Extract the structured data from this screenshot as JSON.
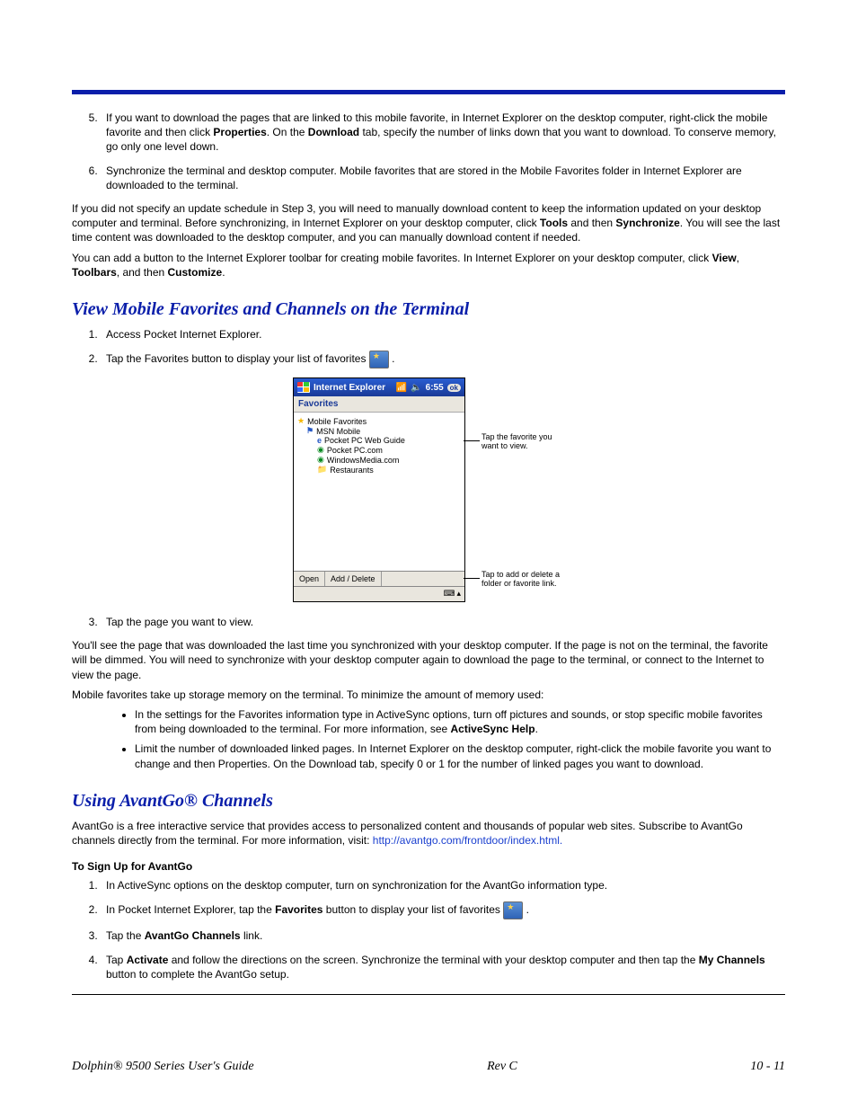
{
  "steps_top": {
    "s5_a": "If you want to download the pages that are linked to this mobile favorite, in Internet Explorer on the desktop computer, right-click the mobile favorite and then click ",
    "s5_b1": "Properties",
    "s5_c": ". On the ",
    "s5_b2": "Download",
    "s5_d": " tab, specify the number of links down that you want to download. To conserve memory, go only one level down.",
    "s6": "Synchronize the terminal and desktop computer. Mobile favorites that are stored in the Mobile Favorites folder in Internet Explorer are downloaded to the terminal."
  },
  "para1": {
    "a": "If you did not specify an update schedule in Step 3, you will need to manually download content to keep the information updated on your desktop computer and terminal. Before synchronizing, in Internet Explorer on your desktop computer, click ",
    "b1": "Tools",
    "b": " and then ",
    "b2": "Synchronize",
    "c": ". You will see the last time content was downloaded to the desktop computer, and you can manually download content if needed."
  },
  "para2": {
    "a": "You can add a button to the Internet Explorer toolbar for creating mobile favorites. In Internet Explorer on your desktop computer, click ",
    "b1": "View",
    "s1": ", ",
    "b2": "Toolbars",
    "s2": ", and then ",
    "b3": "Customize",
    "end": "."
  },
  "heading1": "View Mobile Favorites and Channels on the Terminal",
  "vmf_steps": {
    "s1": "Access Pocket Internet Explorer.",
    "s2": "Tap the Favorites button to display your list of favorites ",
    "s3": "Tap the page you want to view."
  },
  "screenshot": {
    "title": "Internet Explorer",
    "time": "6:55",
    "ok": "ok",
    "fav_label": "Favorites",
    "items": {
      "root": "Mobile Favorites",
      "i1": "MSN Mobile",
      "i2": "Pocket PC Web Guide",
      "i3": "Pocket PC.com",
      "i4": "WindowsMedia.com",
      "i5": "Restaurants"
    },
    "toolbar": {
      "open": "Open",
      "add": "Add / Delete"
    },
    "callout1": "Tap the favorite you want to view.",
    "callout2": "Tap to add or delete a folder or favorite link."
  },
  "para3": "You'll see the page that was downloaded the last time you synchronized with your desktop computer. If the page is not on the terminal, the favorite will be dimmed. You will need to synchronize with your desktop computer again to download the page to the terminal, or connect to the Internet to view the page.",
  "para4": "Mobile favorites take up storage memory on the terminal. To minimize the amount of memory used:",
  "bullets": {
    "b1a": "In the settings for the Favorites information type in ActiveSync options, turn off pictures and sounds, or stop specific mobile favorites from being downloaded to the terminal. For more information, see ",
    "b1b": "ActiveSync Help",
    "b1c": ".",
    "b2": "Limit the number of downloaded linked pages. In Internet Explorer on the desktop computer, right-click the mobile favorite you want to change and then Properties. On the Download tab, specify 0 or 1 for the number of linked pages you want to download."
  },
  "heading2": "Using AvantGo® Channels",
  "avant_intro": {
    "a": "AvantGo is a free interactive service that provides access to personalized content and thousands of popular web sites. Subscribe to AvantGo channels directly from the terminal. For more information, visit:  ",
    "url": "http://avantgo.com/frontdoor/index.html."
  },
  "signup_h": "To Sign Up for AvantGo",
  "signup_steps": {
    "s1": "In ActiveSync options on the desktop computer, turn on synchronization for the AvantGo information type.",
    "s2a": "In Pocket Internet Explorer, tap the ",
    "s2b": "Favorites",
    "s2c": " button to display your list of favorites ",
    "s3a": "Tap the ",
    "s3b": "AvantGo Channels",
    "s3c": " link.",
    "s4a": "Tap ",
    "s4b": "Activate",
    "s4c": " and follow the directions on the screen. Synchronize the terminal with your desktop computer and then tap the ",
    "s4d": "My Channels",
    "s4e": " button to complete the AvantGo setup."
  },
  "footer": {
    "left": "Dolphin® 9500 Series User's Guide",
    "center": "Rev C",
    "right": "10 - 11"
  }
}
